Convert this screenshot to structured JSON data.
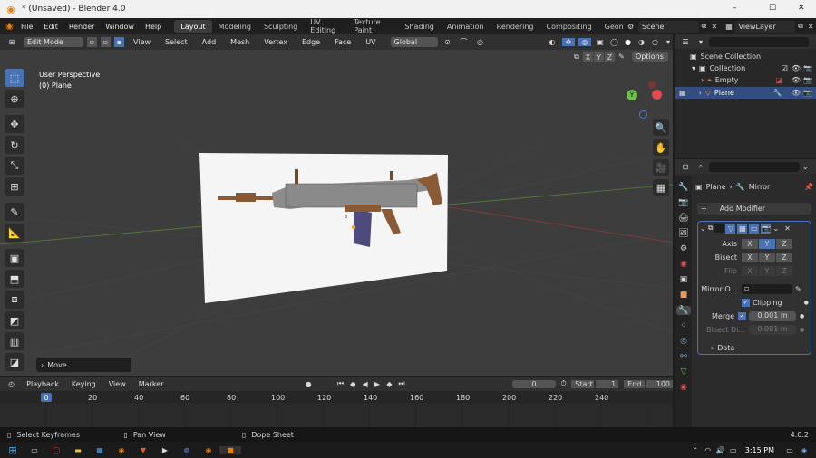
{
  "window": {
    "title": "* (Unsaved) - Blender 4.0",
    "minimize": "–",
    "maximize": "☐",
    "close": "✕"
  },
  "menus": [
    "File",
    "Edit",
    "Render",
    "Window",
    "Help"
  ],
  "workspaces": [
    "Layout",
    "Modeling",
    "Sculpting",
    "UV Editing",
    "Texture Paint",
    "Shading",
    "Animation",
    "Rendering",
    "Compositing",
    "Geomet"
  ],
  "scene_name": "Scene",
  "view_layer_name": "ViewLayer",
  "viewport_header": {
    "mode": "Edit Mode",
    "menus": [
      "View",
      "Select",
      "Add",
      "Mesh",
      "Vertex",
      "Edge",
      "Face",
      "UV"
    ],
    "transform_orientation": "Global",
    "options": "Options"
  },
  "mirror_axes": [
    "X",
    "Y",
    "Z"
  ],
  "viewport_overlay": {
    "perspective": "User Perspective",
    "object": "(0) Plane"
  },
  "gizmo": {
    "y": "Y"
  },
  "last_operator": "Move",
  "outliner": {
    "root": "Scene Collection",
    "collection": "Collection",
    "items": [
      {
        "label": "Empty",
        "selected": false
      },
      {
        "label": "Plane",
        "selected": true
      }
    ]
  },
  "properties": {
    "object": "Plane",
    "modifier": "Mirror",
    "add_modifier": "Add Modifier",
    "axis_label": "Axis",
    "bisect_label": "Bisect",
    "flip_label": "Flip",
    "axes": [
      "X",
      "Y",
      "Z"
    ],
    "mirror_object_label": "Mirror O...",
    "clipping_label": "Clipping",
    "merge_label": "Merge",
    "merge_value": "0.001 m",
    "bisect_distance_label": "Bisect Di...",
    "bisect_distance_value": "0.001 m",
    "data_label": "Data"
  },
  "timeline": {
    "menus": [
      "Playback",
      "Keying",
      "View",
      "Marker"
    ],
    "current_frame": "0",
    "start_label": "Start",
    "start": "1",
    "end_label": "End",
    "end": "100",
    "ticks": [
      "0",
      "20",
      "40",
      "60",
      "80",
      "100",
      "120",
      "140",
      "160",
      "180",
      "200",
      "220",
      "240"
    ]
  },
  "statusbar": {
    "hint1": "Select Keyframes",
    "hint2": "Pan View",
    "hint3": "Dope Sheet",
    "version": "4.0.2"
  },
  "taskbar": {
    "clock": "3:15 PM"
  },
  "colors": {
    "accent": "#4772b3",
    "bg": "#3d3d3d",
    "gizmo_y": "#6ec24a",
    "gizmo_x": "#e5484d"
  }
}
